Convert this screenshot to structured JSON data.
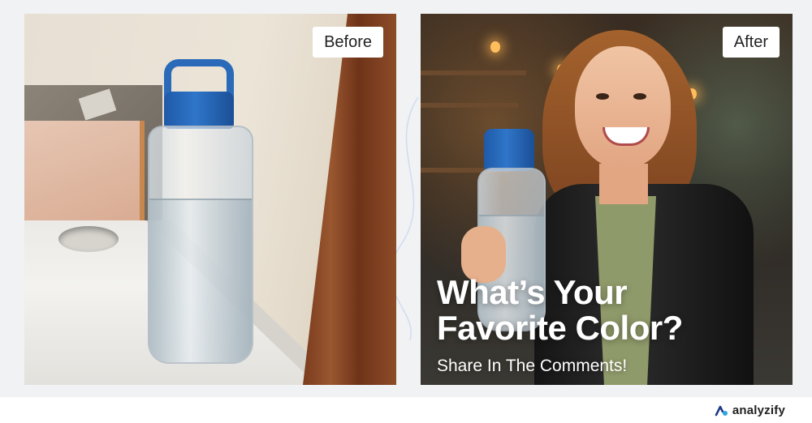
{
  "labels": {
    "before": "Before",
    "after": "After"
  },
  "overlay": {
    "headline_line1": "What’s Your",
    "headline_line2": "Favorite Color?",
    "subtext": "Share In The Comments!"
  },
  "brand": {
    "name": "analyzify",
    "icon": "analyzify-logo-icon"
  },
  "colors": {
    "cap_blue": "#2f75c9",
    "page_bg": "#f1f2f4"
  }
}
